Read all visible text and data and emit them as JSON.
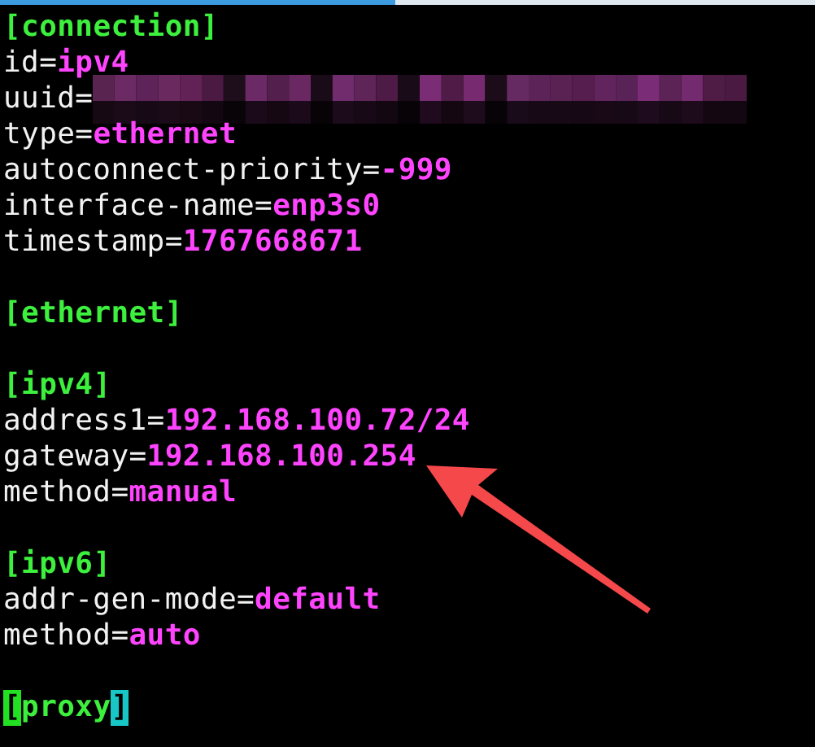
{
  "lines": [
    {
      "kind": "section",
      "open": "[",
      "name": "connection",
      "close": "]",
      "cursor_on_brackets": false
    },
    {
      "kind": "pair",
      "key": "id=",
      "value": "ipv4"
    },
    {
      "kind": "redacted",
      "key": "uuid="
    },
    {
      "kind": "pair",
      "key": "type=",
      "value": "ethernet"
    },
    {
      "kind": "pair",
      "key": "autoconnect-priority=",
      "value": "-999"
    },
    {
      "kind": "pair",
      "key": "interface-name=",
      "value": "enp3s0"
    },
    {
      "kind": "pair",
      "key": "timestamp=",
      "value": "1767668671"
    },
    {
      "kind": "blank"
    },
    {
      "kind": "section",
      "open": "[",
      "name": "ethernet",
      "close": "]",
      "cursor_on_brackets": false
    },
    {
      "kind": "blank"
    },
    {
      "kind": "section",
      "open": "[",
      "name": "ipv4",
      "close": "]",
      "cursor_on_brackets": false
    },
    {
      "kind": "pair",
      "key": "address1=",
      "value": "192.168.100.72/24"
    },
    {
      "kind": "pair",
      "key": "gateway=",
      "value": "192.168.100.254"
    },
    {
      "kind": "pair",
      "key": "method=",
      "value": "manual"
    },
    {
      "kind": "blank"
    },
    {
      "kind": "section",
      "open": "[",
      "name": "ipv6",
      "close": "]",
      "cursor_on_brackets": false
    },
    {
      "kind": "pair",
      "key": "addr-gen-mode=",
      "value": "default"
    },
    {
      "kind": "pair",
      "key": "method=",
      "value": "auto"
    },
    {
      "kind": "blank"
    },
    {
      "kind": "section",
      "open": "[",
      "name": "proxy",
      "close": "]",
      "cursor_on_brackets": true
    }
  ]
}
